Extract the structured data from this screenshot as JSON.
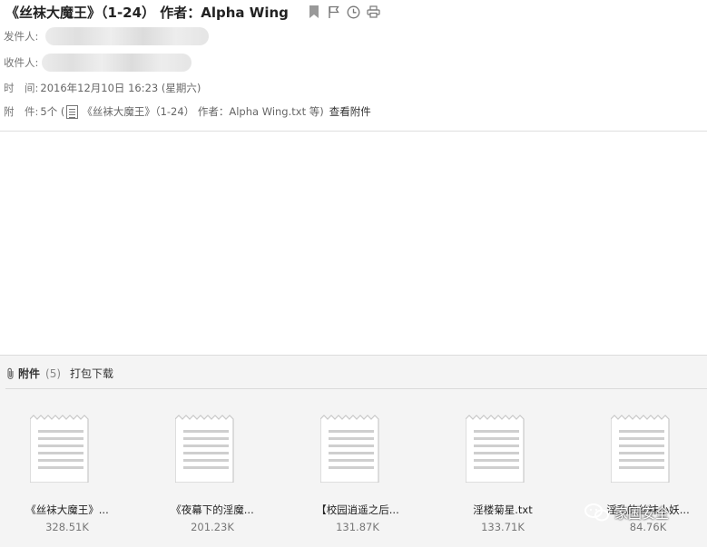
{
  "email": {
    "subject": "《丝袜大魔王》（1-24）  作者：Alpha Wing",
    "from_label": "发件人:",
    "to_label": "收件人:",
    "time_label": "时　间:",
    "time_value": "2016年12月10日 16:23 (星期六)",
    "att_label": "附　件:",
    "att_summary_count": "5个 (",
    "att_summary_name": "《丝袜大魔王》（1-24） 作者：Alpha Wing.txt 等)",
    "view_attachments": "查看附件"
  },
  "attachments_panel": {
    "title": "附件",
    "count": "(5)",
    "pack_download": "打包下载",
    "files": [
      {
        "name": "《丝袜大魔王》...",
        "size": "328.51K"
      },
      {
        "name": "《夜幕下的淫魔...",
        "size": "201.23K"
      },
      {
        "name": "【校园逍遥之后...",
        "size": "131.87K"
      },
      {
        "name": "淫楼菊星.txt",
        "size": "133.71K"
      },
      {
        "name": "淫乱的丝袜小妖...",
        "size": "84.76K"
      }
    ]
  },
  "watermark": {
    "text": "家国安全"
  },
  "icons": [
    "bookmark-icon",
    "flag-icon",
    "clock-icon",
    "print-icon",
    "paperclip-icon",
    "text-file-icon"
  ],
  "colors": {
    "panel_bg": "#f4f4f4",
    "icon_gray": "#888888",
    "text_dark": "#222222",
    "text_muted": "#777777"
  }
}
